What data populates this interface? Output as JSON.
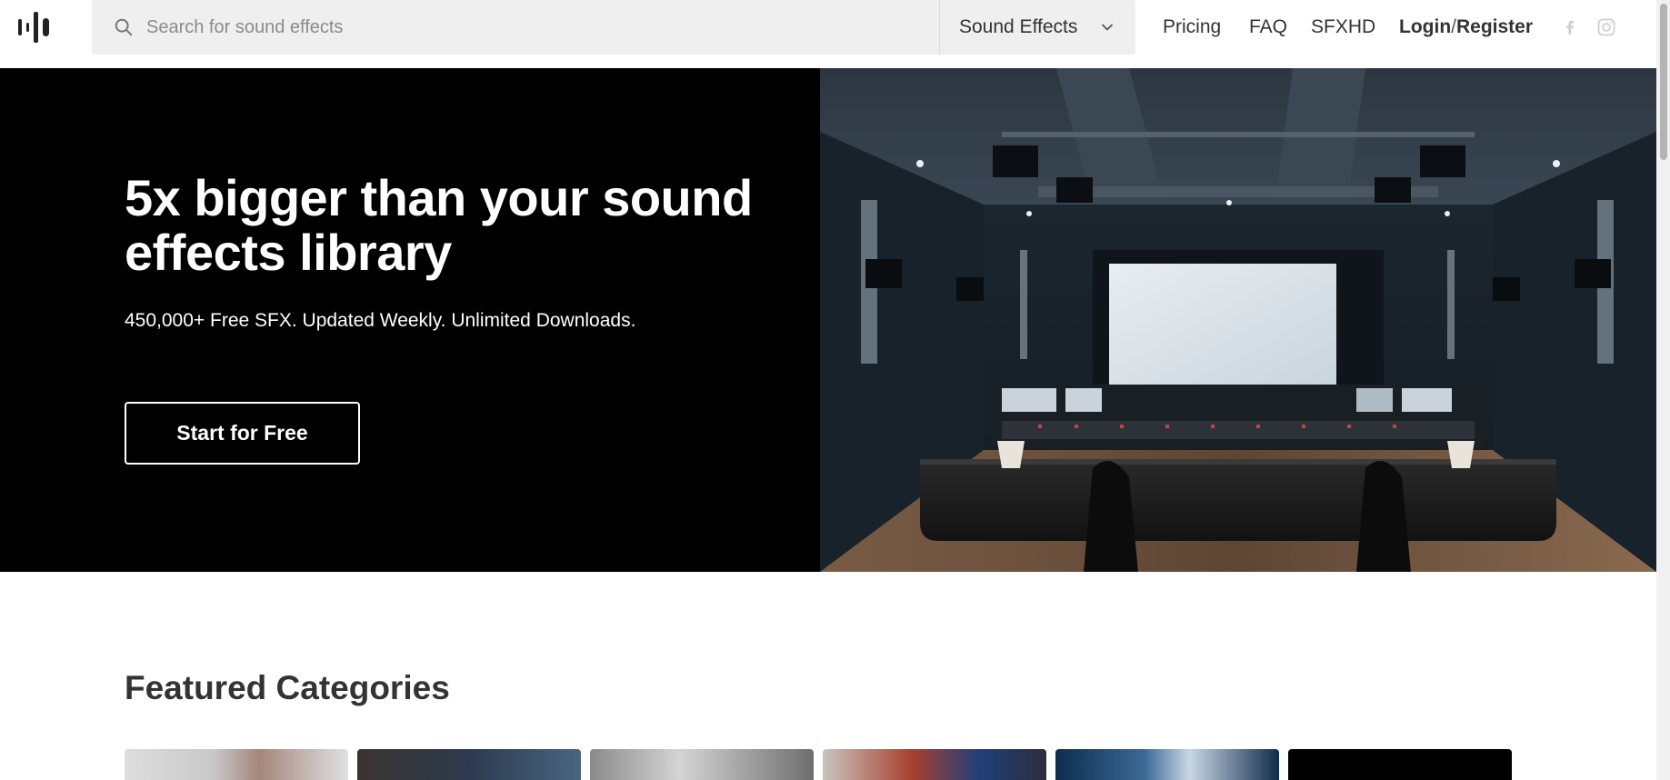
{
  "header": {
    "search": {
      "placeholder": "Search for sound effects",
      "value": ""
    },
    "category_select": {
      "selected": "Sound Effects"
    },
    "nav": {
      "pricing": "Pricing",
      "faq": "FAQ",
      "sfxhd": "SFXHD",
      "login": "Login",
      "slash": "/",
      "register": "Register"
    },
    "social": [
      "facebook-icon",
      "instagram-icon"
    ]
  },
  "hero": {
    "title": "5x bigger than your sound effects library",
    "subtitle": "450,000+ Free SFX. Updated Weekly. Unlimited Downloads.",
    "cta": "Start for Free",
    "image": "studio-mixing-room-photo"
  },
  "featured": {
    "title": "Featured Categories",
    "cards": 6
  },
  "colors": {
    "hero_bg": "#000000",
    "text_light": "#ffffff",
    "search_bg": "#efefef",
    "text_dark": "#333333"
  }
}
